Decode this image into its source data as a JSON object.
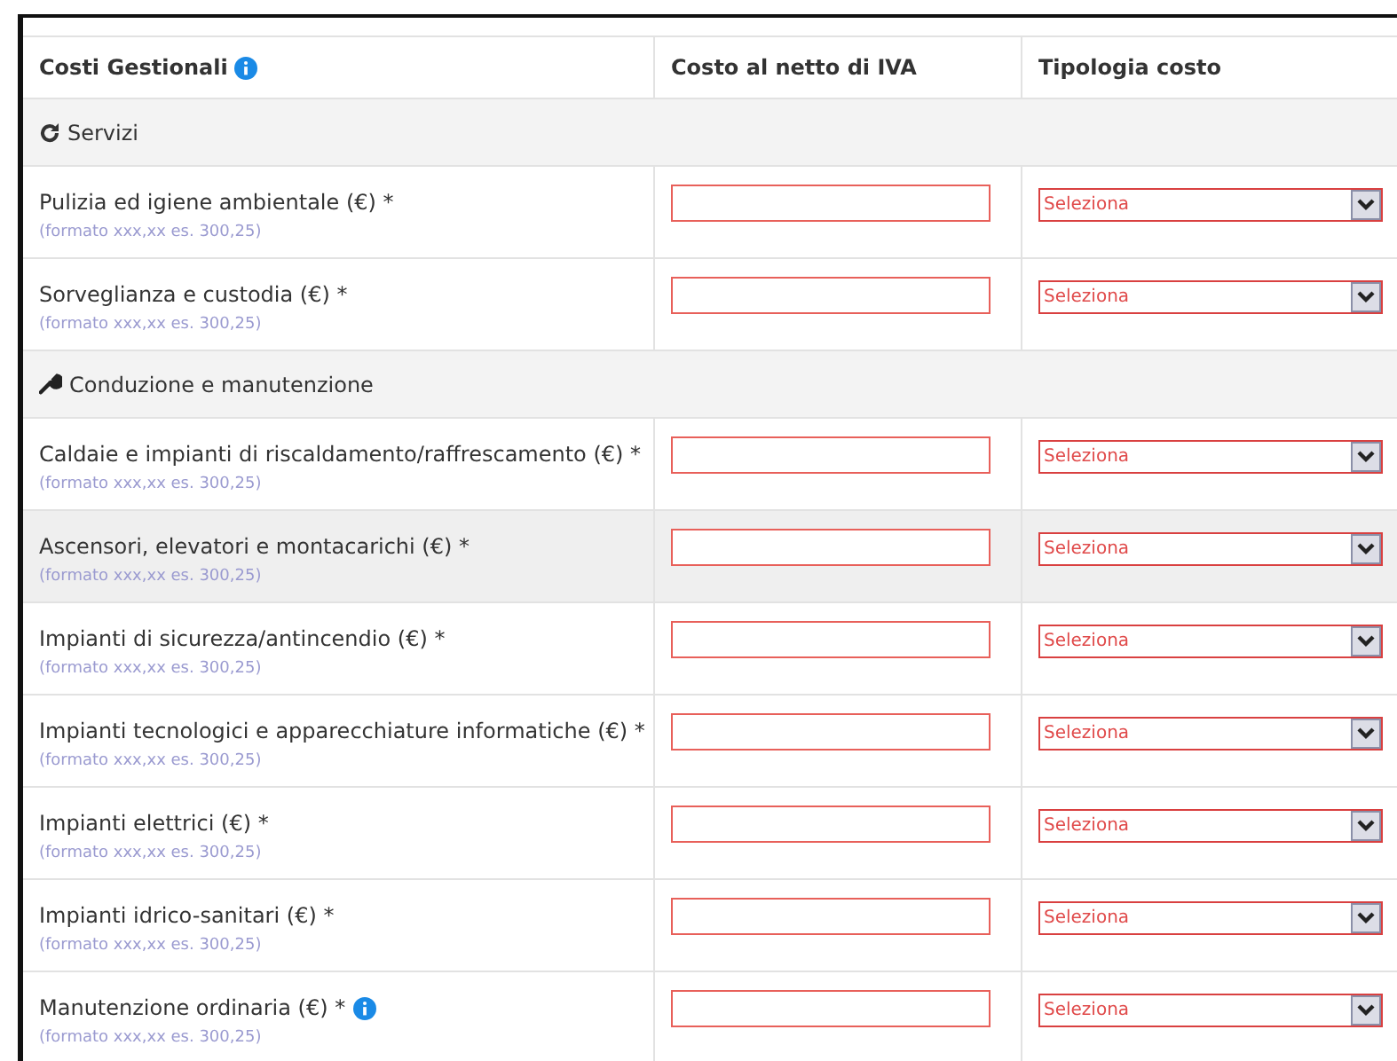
{
  "table": {
    "columns": [
      {
        "label": "Costi Gestionali",
        "info": true
      },
      {
        "label": "Costo al netto di IVA",
        "info": false
      },
      {
        "label": "Tipologia costo",
        "info": false
      }
    ],
    "rows": [
      {
        "kind": "section",
        "label": "Servizi"
      },
      {
        "kind": "item",
        "label": "Pulizia ed igiene ambientale (€) *",
        "hint": "(formato xxx,xx es. 300,25)",
        "select": "Seleziona",
        "highlighted": false,
        "info": false
      },
      {
        "kind": "item",
        "label": "Sorveglianza e custodia (€) *",
        "hint": "(formato xxx,xx es. 300,25)",
        "select": "Seleziona",
        "highlighted": false,
        "info": false
      },
      {
        "kind": "section",
        "label": "Conduzione e manutenzione"
      },
      {
        "kind": "item",
        "label": "Caldaie e impianti di riscaldamento/raffrescamento (€) *",
        "hint": "(formato xxx,xx es. 300,25)",
        "select": "Seleziona",
        "highlighted": false,
        "info": false
      },
      {
        "kind": "item",
        "label": "Ascensori, elevatori e montacarichi (€) *",
        "hint": "(formato xxx,xx es. 300,25)",
        "select": "Seleziona",
        "highlighted": true,
        "info": false
      },
      {
        "kind": "item",
        "label": "Impianti di sicurezza/antincendio (€) *",
        "hint": "(formato xxx,xx es. 300,25)",
        "select": "Seleziona",
        "highlighted": false,
        "info": false
      },
      {
        "kind": "item",
        "label": "Impianti tecnologici e apparecchiature informatiche (€) *",
        "hint": "(formato xxx,xx es. 300,25)",
        "select": "Seleziona",
        "highlighted": false,
        "info": false
      },
      {
        "kind": "item",
        "label": "Impianti elettrici (€) *",
        "hint": "(formato xxx,xx es. 300,25)",
        "select": "Seleziona",
        "highlighted": false,
        "info": false
      },
      {
        "kind": "item",
        "label": "Impianti idrico-sanitari (€) *",
        "hint": "(formato xxx,xx es. 300,25)",
        "select": "Seleziona",
        "highlighted": false,
        "info": false
      },
      {
        "kind": "item",
        "label": "Manutenzione ordinaria (€) *",
        "hint": "(formato xxx,xx es. 300,25)",
        "select": "Seleziona",
        "highlighted": false,
        "info": true
      }
    ]
  }
}
